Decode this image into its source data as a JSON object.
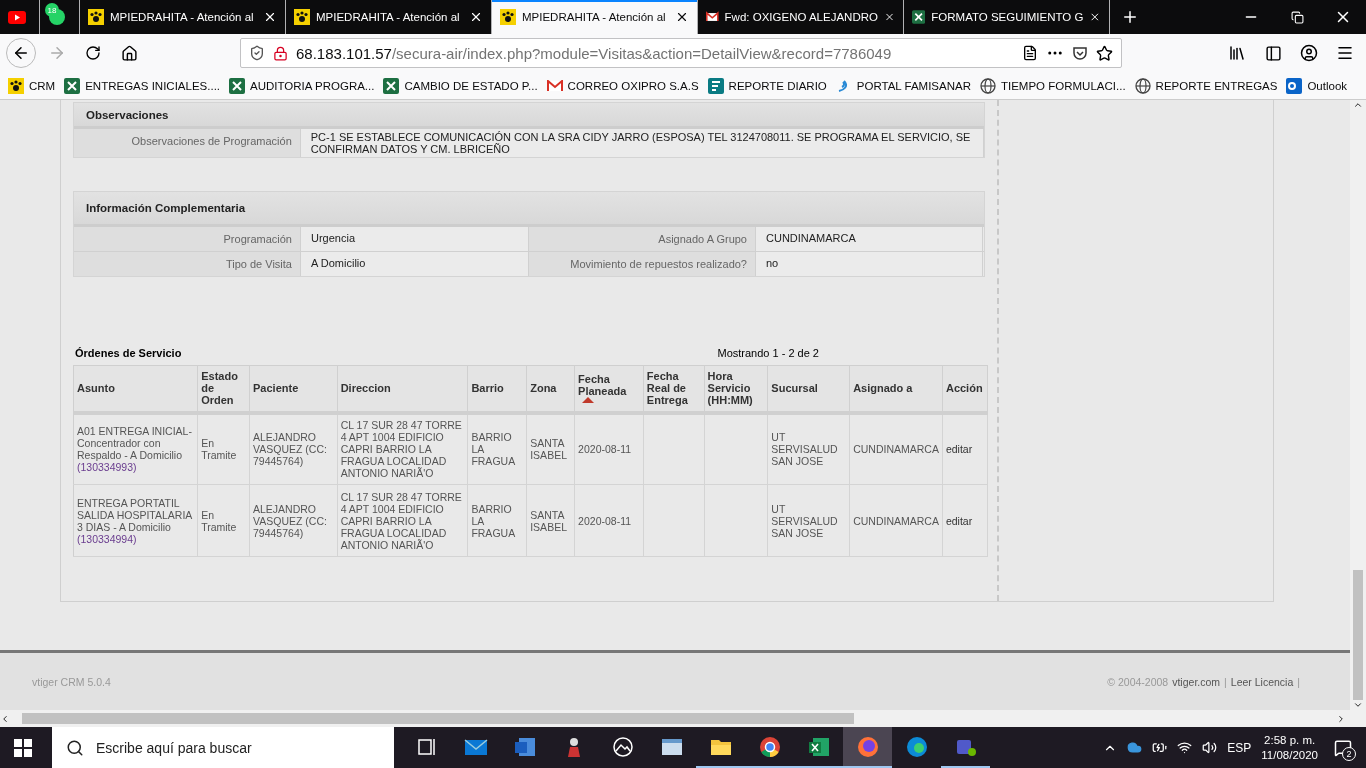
{
  "tabs": [
    {
      "kind": "youtube",
      "selected": false
    },
    {
      "kind": "whatsapp",
      "badge": "18",
      "selected": false
    },
    {
      "kind": "vtiger",
      "title": "MPIEDRAHITA - Atención al",
      "selected": false
    },
    {
      "kind": "vtiger",
      "title": "MPIEDRAHITA - Atención al",
      "selected": false
    },
    {
      "kind": "vtiger",
      "title": "MPIEDRAHITA - Atención al",
      "selected": true
    },
    {
      "kind": "gmail",
      "title": "Fwd: OXIGENO ALEJANDRO",
      "selected": false
    },
    {
      "kind": "excel",
      "title": "FORMATO SEGUIMIENTO G",
      "selected": false
    }
  ],
  "address": {
    "host": "68.183.101.57",
    "path": "/secura-air/index.php?module=Visitas&action=DetailView&record=7786049"
  },
  "bookmarks": [
    {
      "kind": "vtiger",
      "label": "CRM"
    },
    {
      "kind": "excel",
      "label": "ENTREGAS INICIALES...."
    },
    {
      "kind": "excel",
      "label": "AUDITORIA PROGRA..."
    },
    {
      "kind": "excel",
      "label": "CAMBIO DE ESTADO P..."
    },
    {
      "kind": "gmail",
      "label": "CORREO OXIPRO S.A.S"
    },
    {
      "kind": "forms",
      "label": "REPORTE DIARIO"
    },
    {
      "kind": "swirl",
      "label": "PORTAL FAMISANAR"
    },
    {
      "kind": "globe",
      "label": "TIEMPO FORMULACI..."
    },
    {
      "kind": "globe",
      "label": "REPORTE ENTREGAS"
    },
    {
      "kind": "outlook",
      "label": "Outlook"
    }
  ],
  "observaciones": {
    "title": "Observaciones",
    "label": "Observaciones de Programación",
    "value": "PC-1 SE ESTABLECE COMUNICACIÓN CON LA SRA CIDY JARRO (ESPOSA) TEL 3124708011. SE PROGRAMA EL SERVICIO, SE CONFIRMAN DATOS Y CM. LBRICEÑO"
  },
  "informacion": {
    "title": "Información Complementaria",
    "rows": [
      [
        {
          "label": "Programación",
          "value": "Urgencia"
        },
        {
          "label": "Asignado A Grupo",
          "value": "CUNDINAMARCA"
        }
      ],
      [
        {
          "label": "Tipo de Visita",
          "value": "A Domicilio"
        },
        {
          "label": "Movimiento de repuestos realizado?",
          "value": "no"
        }
      ]
    ]
  },
  "ordenes": {
    "title": "Órdenes de Servicio",
    "count": "Mostrando 1 - 2 de 2",
    "columns": [
      {
        "label": "Asunto",
        "sorted": false
      },
      {
        "label": "Estado de Orden",
        "sorted": false
      },
      {
        "label": "Paciente",
        "sorted": false
      },
      {
        "label": "Direccion",
        "sorted": false
      },
      {
        "label": "Barrio",
        "sorted": false
      },
      {
        "label": "Zona",
        "sorted": false
      },
      {
        "label": "Fecha Planeada",
        "sorted": true
      },
      {
        "label": "Fecha Real de Entrega",
        "sorted": false
      },
      {
        "label": "Hora Servicio (HH:MM)",
        "sorted": false
      },
      {
        "label": "Sucursal",
        "sorted": false
      },
      {
        "label": "Asignado a",
        "sorted": false
      },
      {
        "label": "Acción",
        "sorted": false
      }
    ],
    "rows": [
      {
        "asunto": "A01 ENTREGA INICIAL-Concentrador con Respaldo - A Domicilio",
        "numero": "(130334993)",
        "estado": "En Tramite",
        "paciente": "ALEJANDRO VASQUEZ (CC: 79445764)",
        "direccion": "CL 17 SUR 28 47 TORRE 4 APT 1004 EDIFICIO CAPRI BARRIO LA FRAGUA LOCALIDAD ANTONIO NARIÃ'O",
        "barrio": "BARRIO LA FRAGUA",
        "zona": "SANTA ISABEL",
        "fecha_planeada": "2020-08-11",
        "sucursal": "UT SERVISALUD SAN JOSE",
        "asignado": "CUNDINAMARCA",
        "accion": "editar"
      },
      {
        "asunto": "ENTREGA PORTATIL SALIDA HOSPITALARIA 3 DIAS - A Domicilio",
        "numero": "(130334994)",
        "estado": "En Tramite",
        "paciente": "ALEJANDRO VASQUEZ (CC: 79445764)",
        "direccion": "CL 17 SUR 28 47 TORRE 4 APT 1004 EDIFICIO CAPRI BARRIO LA FRAGUA LOCALIDAD ANTONIO NARIÃ'O",
        "barrio": "BARRIO LA FRAGUA",
        "zona": "SANTA ISABEL",
        "fecha_planeada": "2020-08-11",
        "sucursal": "UT SERVISALUD SAN JOSE",
        "asignado": "CUNDINAMARCA",
        "accion": "editar"
      }
    ]
  },
  "footer": {
    "version": "vtiger CRM 5.0.4",
    "copyright": "© 2004-2008",
    "site": "vtiger.com",
    "license": "Leer Licencia",
    "separators": [
      "|",
      "|"
    ]
  },
  "taskbar": {
    "search_placeholder": "Escribe aquí para buscar",
    "apps": [
      {
        "kind": "taskview",
        "open": false,
        "selected": false
      },
      {
        "kind": "mail",
        "open": false,
        "selected": false
      },
      {
        "kind": "word",
        "open": false,
        "selected": false
      },
      {
        "kind": "figure",
        "open": false,
        "selected": false
      },
      {
        "kind": "photos",
        "open": false,
        "selected": false
      },
      {
        "kind": "window",
        "open": false,
        "selected": false
      },
      {
        "kind": "folder",
        "open": true,
        "selected": false
      },
      {
        "kind": "chrome",
        "open": true,
        "selected": false
      },
      {
        "kind": "excel",
        "open": true,
        "selected": false
      },
      {
        "kind": "firefox",
        "open": true,
        "selected": true
      },
      {
        "kind": "edge",
        "open": false,
        "selected": false
      },
      {
        "kind": "teams",
        "open": true,
        "selected": false
      }
    ],
    "language": "ESP",
    "time": "2:58 p. m.",
    "date": "11/08/2020",
    "notifications": "2"
  }
}
